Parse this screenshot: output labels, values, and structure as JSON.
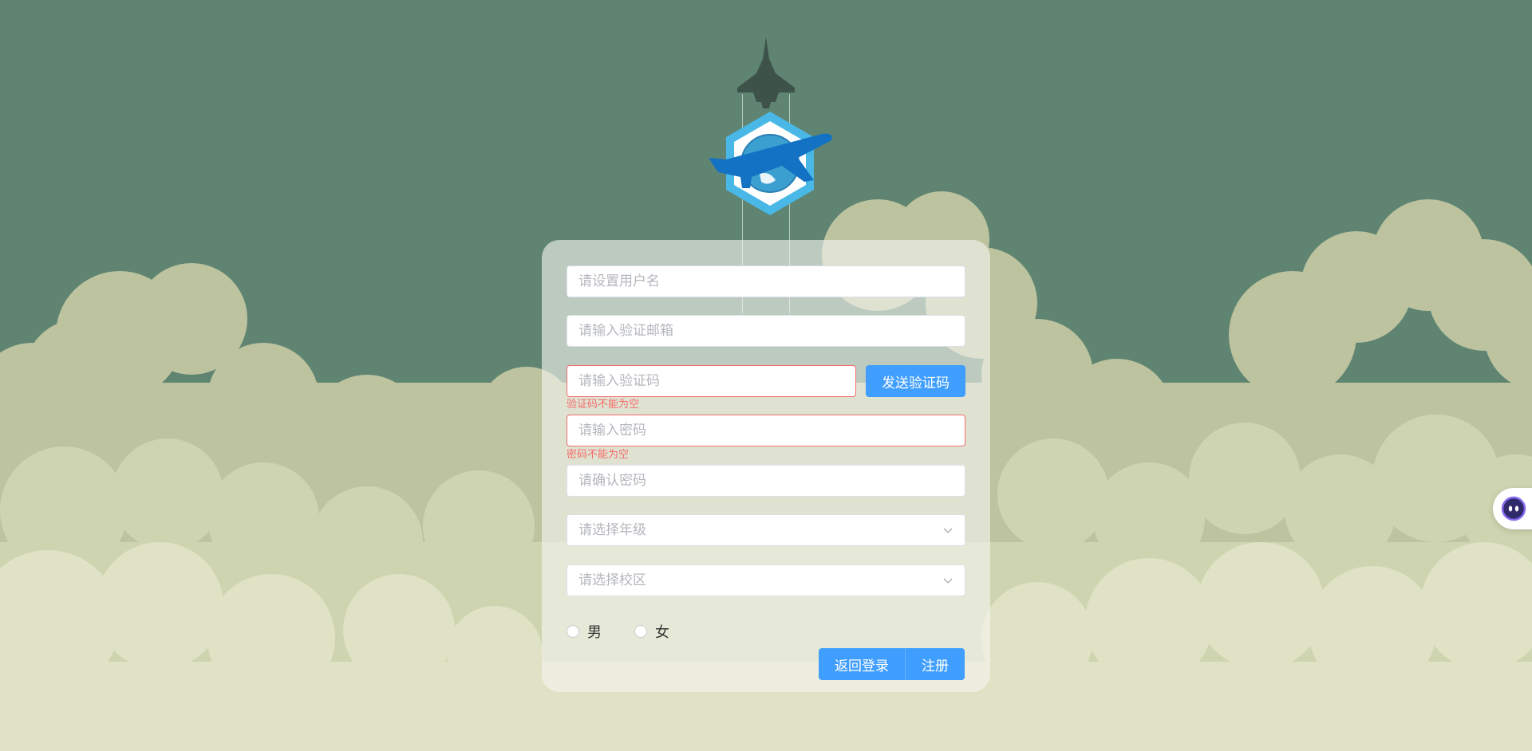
{
  "form": {
    "username_placeholder": "请设置用户名",
    "email_placeholder": "请输入验证邮箱",
    "code_placeholder": "请输入验证码",
    "send_code_label": "发送验证码",
    "code_error": "验证码不能为空",
    "password_placeholder": "请输入密码",
    "password_error": "密码不能为空",
    "confirm_password_placeholder": "请确认密码",
    "grade_placeholder": "请选择年级",
    "campus_placeholder": "请选择校区",
    "gender_options": [
      "男",
      "女"
    ],
    "back_to_login_label": "返回登录",
    "register_label": "注册"
  },
  "icons": {
    "logo": "airplane-globe-hexagon-logo",
    "rocket": "fighter-jet-icon",
    "dropdown": "chevron-down-icon",
    "assistant": "chat-assistant-icon"
  },
  "colors": {
    "background": "#5f8472",
    "primary": "#409eff",
    "error": "#f56c6c",
    "cloud_dark": "#bdc49f",
    "cloud_light": "#dfe2c4"
  }
}
